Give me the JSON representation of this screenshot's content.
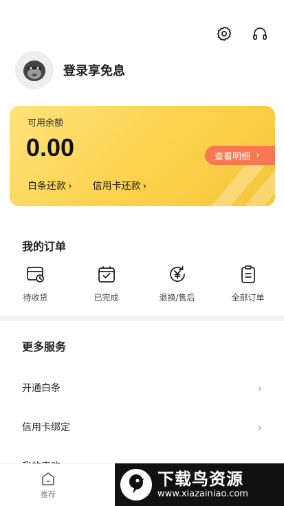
{
  "header": {
    "settings_icon": "gear-icon",
    "support_icon": "headset-icon"
  },
  "profile": {
    "login_text": "登录享免息",
    "avatar_icon": "gorilla-avatar-icon"
  },
  "balance_card": {
    "label": "可用余额",
    "amount": "0.00",
    "detail_button": "查看明细",
    "links": [
      {
        "label": "白条还款"
      },
      {
        "label": "信用卡还款"
      }
    ],
    "gradient_colors": [
      "#ffe27a",
      "#f6c53a"
    ],
    "button_color": "#f77852"
  },
  "orders": {
    "title": "我的订单",
    "items": [
      {
        "label": "待收货",
        "icon": "wallet-clock-icon"
      },
      {
        "label": "已完成",
        "icon": "bag-check-icon"
      },
      {
        "label": "退换/售后",
        "icon": "yen-refresh-icon"
      },
      {
        "label": "全部订单",
        "icon": "clipboard-icon"
      }
    ]
  },
  "services": {
    "title": "更多服务",
    "items": [
      {
        "label": "开通白条"
      },
      {
        "label": "信用卡绑定"
      },
      {
        "label": "我的喜欢"
      }
    ]
  },
  "bottom_nav": {
    "items": [
      {
        "label": "推荐",
        "icon": "home-icon"
      }
    ]
  },
  "watermark": {
    "title": "下载鸟资源",
    "url": "www.xiazainiao.com"
  }
}
